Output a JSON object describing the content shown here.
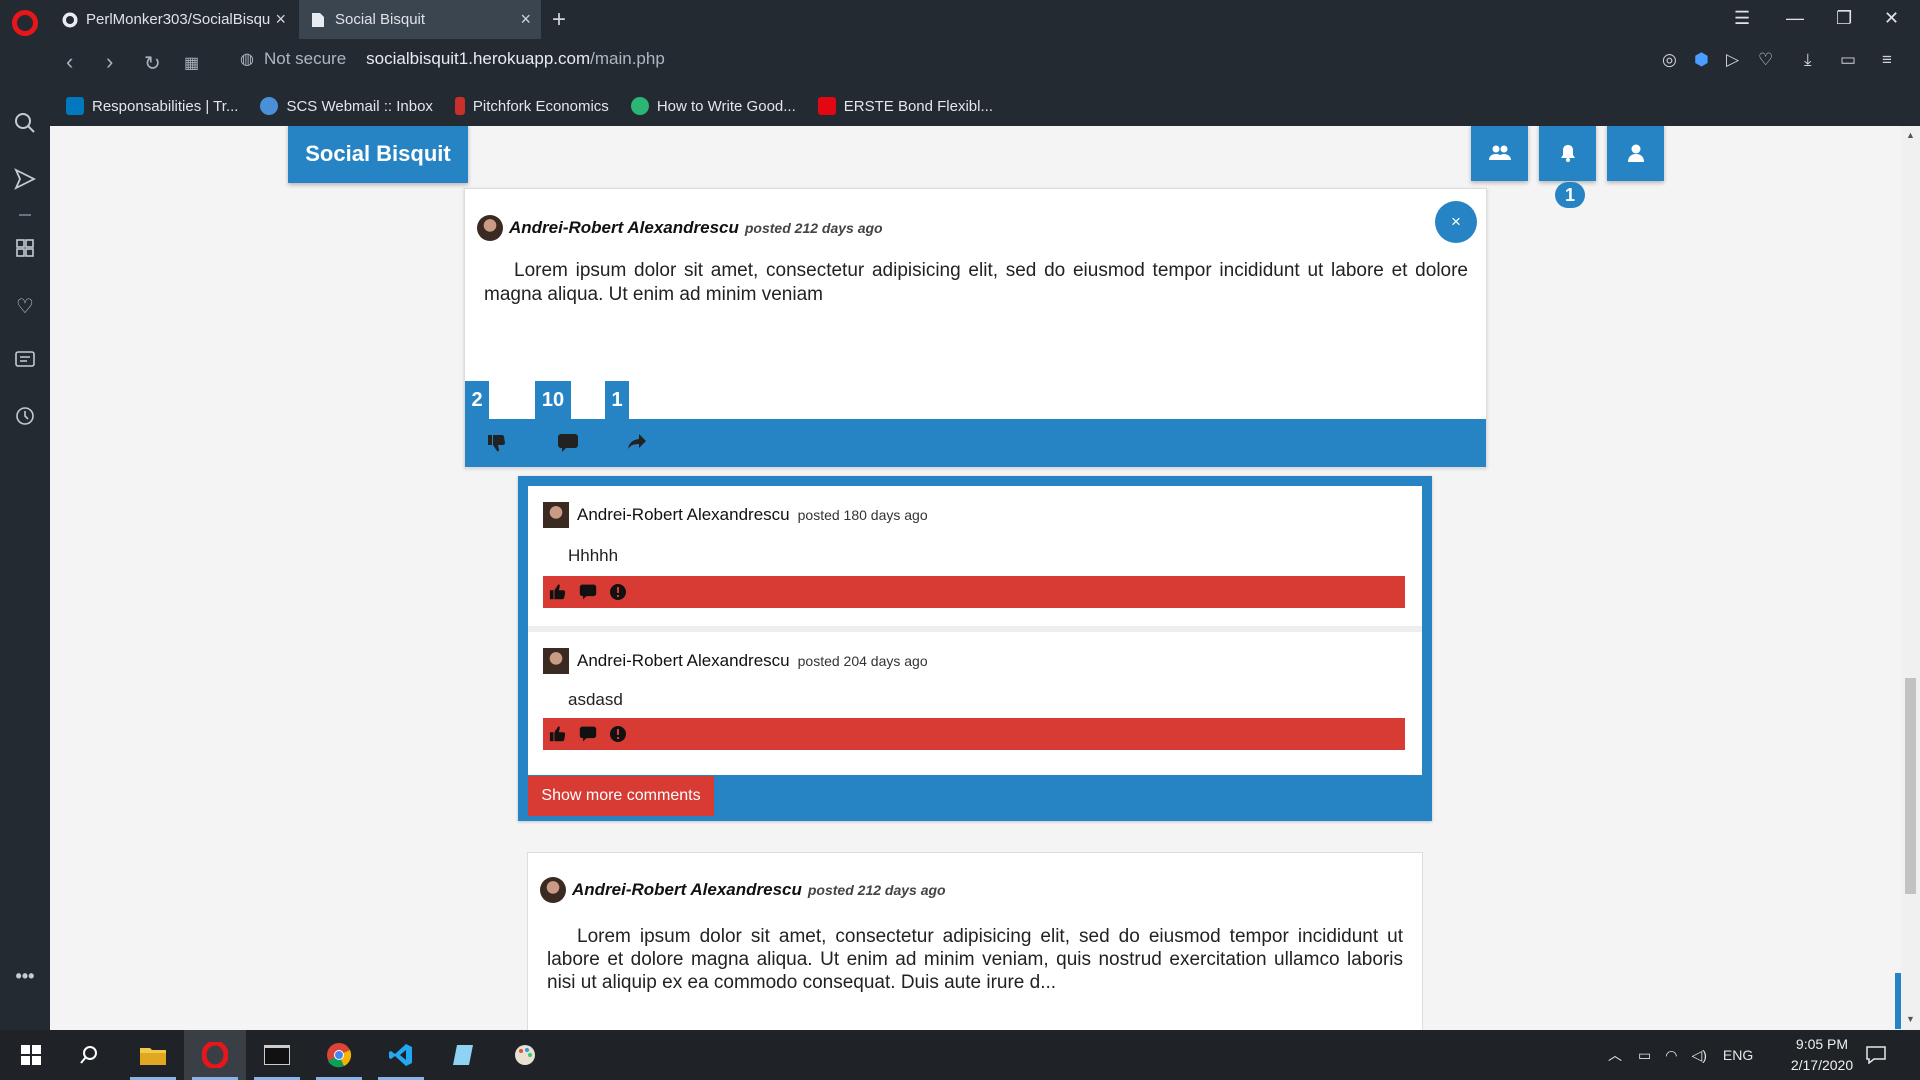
{
  "browser": {
    "tabs": [
      {
        "title": "PerlMonker303/SocialBisqu",
        "active": false
      },
      {
        "title": "Social Bisquit",
        "active": true
      }
    ],
    "security_label": "Not secure",
    "url_host": "socialbisquit1.herokuapp.com",
    "url_path": "/main.php",
    "bookmarks": [
      {
        "label": "Responsabilities | Tr...",
        "color": "#0079bf"
      },
      {
        "label": "SCS Webmail :: Inbox",
        "color": "#4a90d9"
      },
      {
        "label": "Pitchfork Economics",
        "color": "#c9302c"
      },
      {
        "label": "How to Write Good...",
        "color": "#2bb673"
      },
      {
        "label": "ERSTE Bond Flexibl...",
        "color": "#e30613"
      }
    ]
  },
  "app": {
    "brand": "Social Bisquit",
    "notification_count": "1",
    "accent_color": "#2684c5",
    "danger_color": "#d83b33"
  },
  "post1": {
    "author": "Andrei-Robert Alexandrescu",
    "posted": "posted 212 days ago",
    "body": "Lorem ipsum dolor sit amet, consectetur adipisicing elit, sed do eiusmod tempor incididunt ut labore et dolore magna aliqua. Ut enim ad minim veniam",
    "counts": {
      "dislikes": "2",
      "comments": "10",
      "shares": "1"
    },
    "close_icon": "×"
  },
  "comments": [
    {
      "author": "Andrei-Robert Alexandrescu",
      "posted": "posted 180 days ago",
      "text": "Hhhhh"
    },
    {
      "author": "Andrei-Robert Alexandrescu",
      "posted": "posted 204 days ago",
      "text": "asdasd"
    }
  ],
  "show_more_label": "Show more comments",
  "post2": {
    "author": "Andrei-Robert Alexandrescu",
    "posted": "posted 212 days ago",
    "body": "Lorem ipsum dolor sit amet, consectetur adipisicing elit, sed do eiusmod tempor incididunt ut labore et dolore magna aliqua. Ut enim ad minim veniam, quis nostrud exercitation ullamco laboris nisi ut aliquip ex ea commodo consequat. Duis aute irure d..."
  },
  "taskbar": {
    "language": "ENG",
    "time": "9:05 PM",
    "date": "2/17/2020"
  }
}
